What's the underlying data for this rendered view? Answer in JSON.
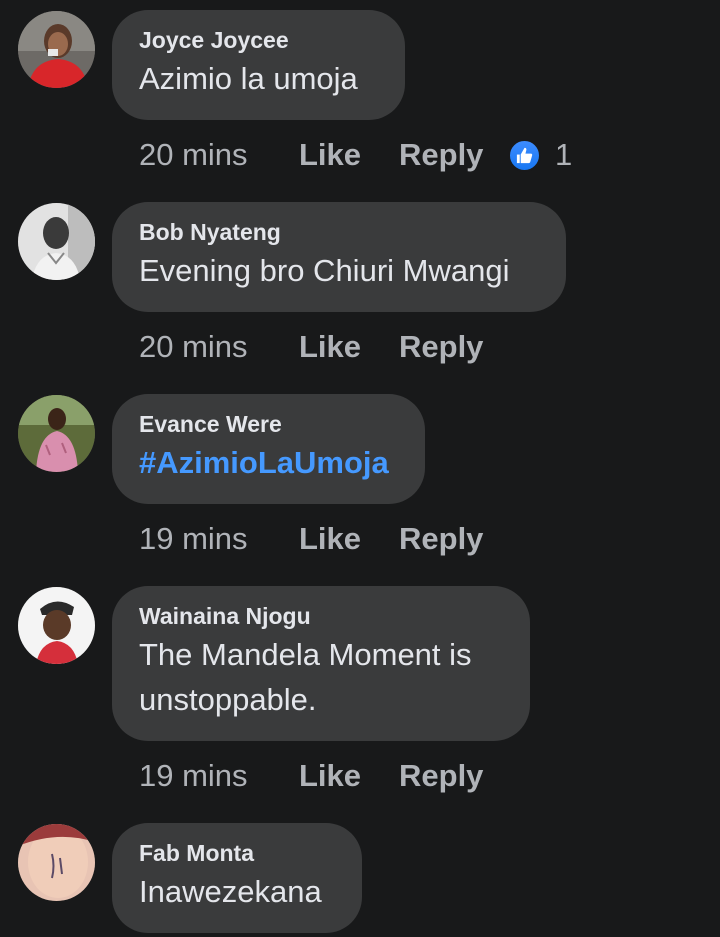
{
  "comments": [
    {
      "author": "Joyce Joycee",
      "text": "Azimio la umoja",
      "time": "20 mins",
      "like_label": "Like",
      "reply_label": "Reply",
      "reaction_count": "1"
    },
    {
      "author": "Bob Nyateng",
      "text": "Evening bro Chiuri Mwangi",
      "time": "20 mins",
      "like_label": "Like",
      "reply_label": "Reply"
    },
    {
      "author": "Evance Were",
      "text": "#AzimioLaUmoja",
      "time": "19 mins",
      "like_label": "Like",
      "reply_label": "Reply"
    },
    {
      "author": "Wainaina Njogu",
      "text_line1": "The Mandela Moment is",
      "text_line2": "unstoppable.",
      "time": "19 mins",
      "like_label": "Like",
      "reply_label": "Reply"
    },
    {
      "author": "Fab Monta",
      "text": "Inawezekana"
    }
  ],
  "colors": {
    "background": "#18191a",
    "bubble": "#3a3b3c",
    "primary_text": "#e4e6eb",
    "secondary_text": "#b0b3b8",
    "hashtag": "#4599ff",
    "like_badge": "#1877f2"
  },
  "icons": {
    "reaction": "thumbs-up-icon"
  }
}
